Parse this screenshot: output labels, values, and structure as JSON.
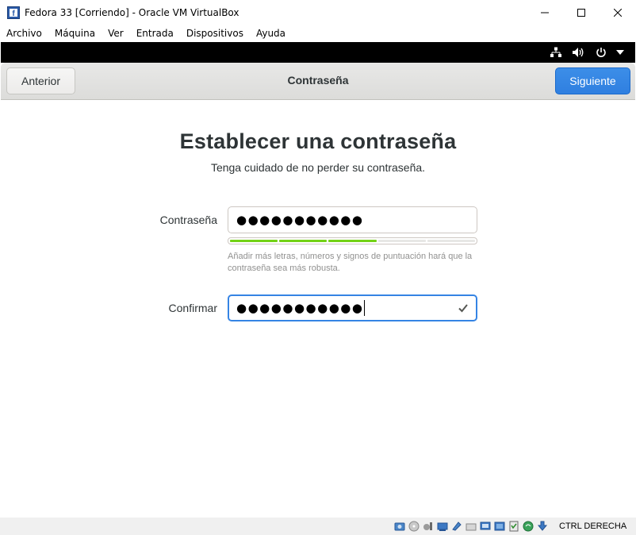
{
  "window": {
    "title": "Fedora 33 [Corriendo] - Oracle VM VirtualBox",
    "controls": [
      "minimize-icon",
      "maximize-icon",
      "close-icon"
    ]
  },
  "menubar": {
    "items": [
      "Archivo",
      "Máquina",
      "Ver",
      "Entrada",
      "Dispositivos",
      "Ayuda"
    ]
  },
  "guest_topbar": {
    "icons": [
      "network-icon",
      "volume-icon",
      "power-icon",
      "chevron-down-icon"
    ]
  },
  "header": {
    "back_label": "Anterior",
    "title": "Contraseña",
    "next_label": "Siguiente"
  },
  "page": {
    "title": "Establecer una contraseña",
    "subtitle": "Tenga cuidado de no perder su contraseña."
  },
  "password": {
    "label": "Contraseña",
    "value_masked": "●●●●●●●●●●●",
    "strength_segments_total": 5,
    "strength_segments_filled": 3,
    "strength_color": "#73d216",
    "hint": "Añadir más letras, números y signos de puntuación hará que la contraseña sea más robusta."
  },
  "confirm": {
    "label": "Confirmar",
    "value_masked": "●●●●●●●●●●●",
    "status_icon": "checkmark-icon"
  },
  "statusbar": {
    "icons": [
      "hard-disk-icon",
      "optical-drive-icon",
      "audio-icon",
      "network-adapter-icon",
      "usb-icon",
      "shared-folder-icon",
      "display-icon",
      "video-capture-icon",
      "virtualization-icon",
      "mouse-integration-icon",
      "keyboard-icon"
    ],
    "host_key": "CTRL DERECHA"
  },
  "colors": {
    "accent": "#3584e4",
    "next_button": "#2f7fe0",
    "header_bg": "#e1e1df"
  }
}
